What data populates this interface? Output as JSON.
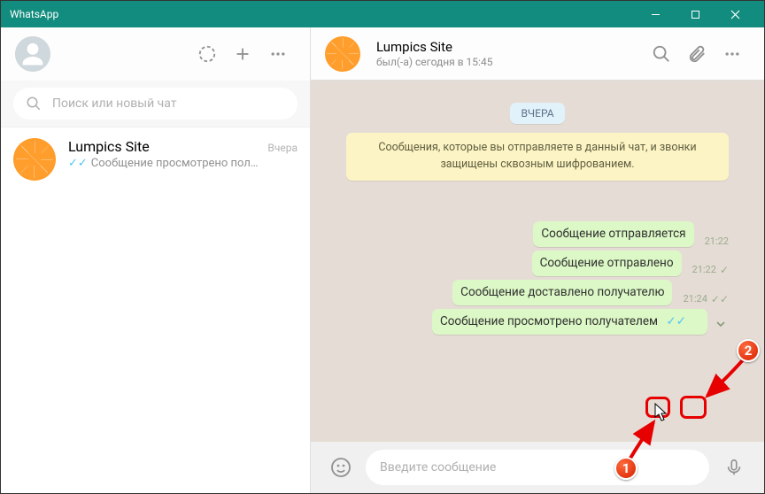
{
  "window": {
    "title": "WhatsApp"
  },
  "left": {
    "search_placeholder": "Поиск или новый чат",
    "chats": [
      {
        "name": "Lumpics Site",
        "time": "Вчера",
        "preview": "Сообщение просмотрено пол…"
      }
    ]
  },
  "chat": {
    "name": "Lumpics Site",
    "status": "был(-а) сегодня в 15:45",
    "day_label": "ВЧЕРА",
    "encryption_notice": "Сообщения, которые вы отправляете в данный чат, и звонки защищены сквозным шифрованием.",
    "messages": [
      {
        "text": "Сообщение отправляется",
        "time": "21:22",
        "ticks": "none",
        "arrow": false
      },
      {
        "text": "Сообщение отправлено",
        "time": "21:22",
        "ticks": "single",
        "arrow": false
      },
      {
        "text": "Сообщение доставлено получателю",
        "time": "21:24",
        "ticks": "double",
        "arrow": false
      },
      {
        "text": "Сообщение просмотрено получателем",
        "time": "",
        "ticks": "read",
        "arrow": true
      }
    ],
    "input_placeholder": "Введите сообщение"
  },
  "annotations": {
    "label1": "1",
    "label2": "2"
  }
}
